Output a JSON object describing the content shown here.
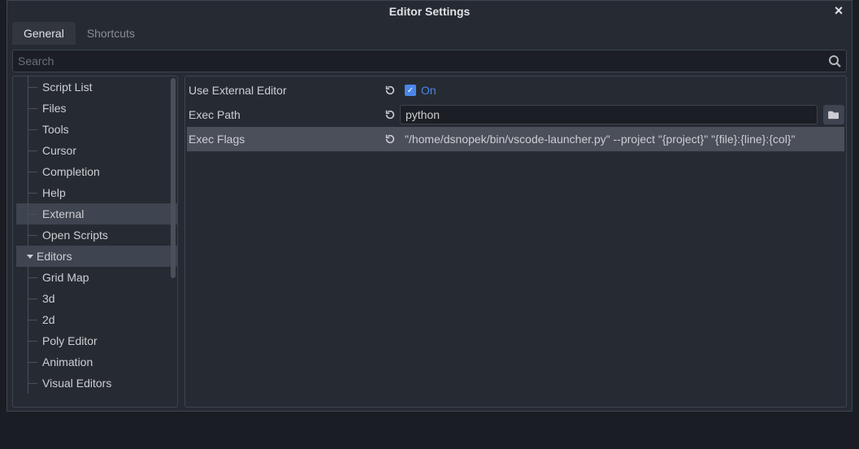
{
  "window": {
    "title": "Editor Settings"
  },
  "tabs": [
    {
      "label": "General",
      "active": true
    },
    {
      "label": "Shortcuts",
      "active": false
    }
  ],
  "search": {
    "placeholder": "Search"
  },
  "sidebar": {
    "items": [
      {
        "label": "Script List",
        "level": 2
      },
      {
        "label": "Files",
        "level": 2
      },
      {
        "label": "Tools",
        "level": 2
      },
      {
        "label": "Cursor",
        "level": 2
      },
      {
        "label": "Completion",
        "level": 2
      },
      {
        "label": "Help",
        "level": 2
      },
      {
        "label": "External",
        "level": 2,
        "selected": true
      },
      {
        "label": "Open Scripts",
        "level": 2
      },
      {
        "label": "Editors",
        "level": 1,
        "expanded": true,
        "selected": true
      },
      {
        "label": "Grid Map",
        "level": 2
      },
      {
        "label": "3d",
        "level": 2
      },
      {
        "label": "2d",
        "level": 2
      },
      {
        "label": "Poly Editor",
        "level": 2
      },
      {
        "label": "Animation",
        "level": 2
      },
      {
        "label": "Visual Editors",
        "level": 2
      }
    ]
  },
  "content": {
    "rows": [
      {
        "label": "Use External Editor",
        "type": "checkbox",
        "checked": true,
        "on_text": "On"
      },
      {
        "label": "Exec Path",
        "type": "path",
        "value": "python"
      },
      {
        "label": "Exec Flags",
        "type": "text",
        "value": "\"/home/dsnopek/bin/vscode-launcher.py\" --project \"{project}\" \"{file}:{line}:{col}\"",
        "highlight": true
      }
    ]
  }
}
